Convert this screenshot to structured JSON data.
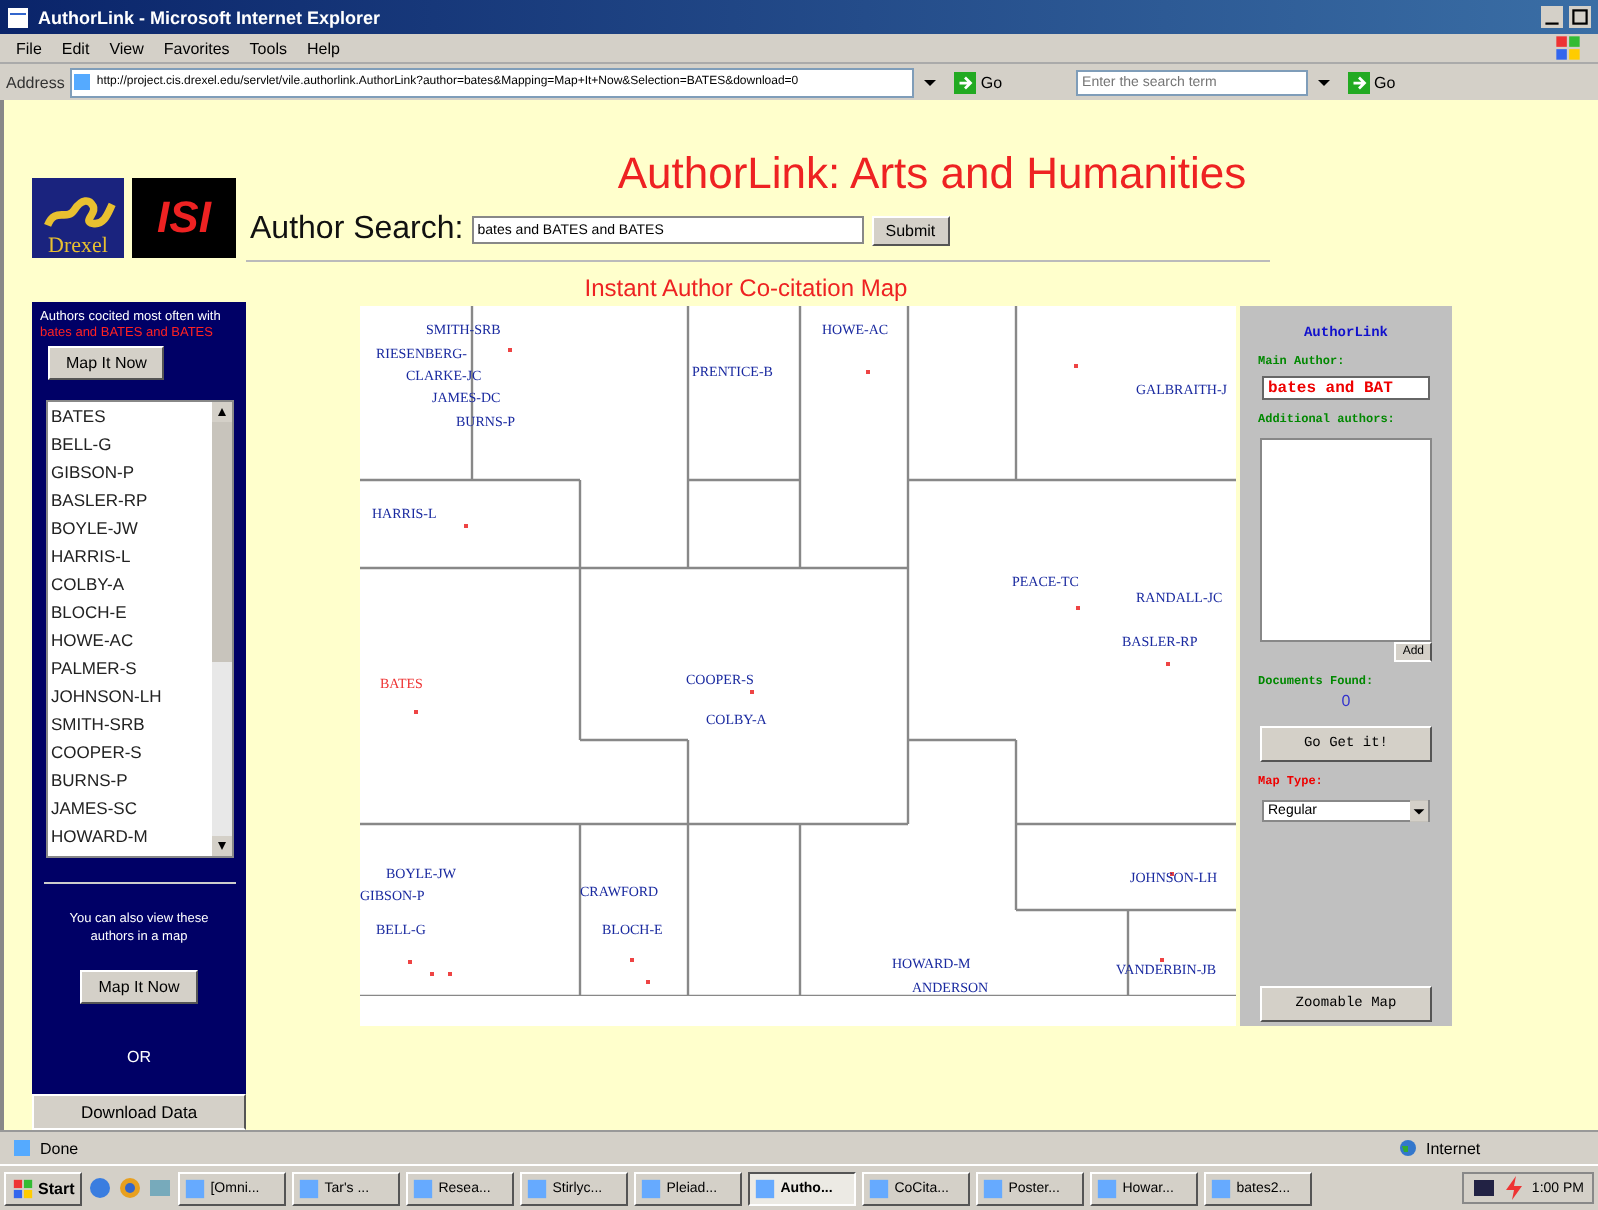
{
  "window": {
    "title": "AuthorLink - Microsoft Internet Explorer"
  },
  "menu": [
    "File",
    "Edit",
    "View",
    "Favorites",
    "Tools",
    "Help"
  ],
  "address_bar": {
    "label": "Address",
    "url": "http://project.cis.drexel.edu/servlet/vile.authorlink.AuthorLink?author=bates&Mapping=Map+It+Now&Selection=BATES&download=0",
    "go": "Go",
    "search_placeholder": "Enter the search term",
    "search_go": "Go"
  },
  "logos": {
    "drexel": "Drexel",
    "isi": "ISI"
  },
  "page_title": "AuthorLink: Arts and Humanities",
  "search": {
    "label": "Author Search:",
    "value": "bates and BATES and BATES",
    "submit": "Submit"
  },
  "sidebar": {
    "intro": "Authors cocited most often with",
    "query": "bates and BATES and BATES",
    "map_button": "Map It Now",
    "authors": [
      {
        "name": "BATES",
        "selected": false
      },
      {
        "name": "BELL-G",
        "selected": false
      },
      {
        "name": "GIBSON-P",
        "selected": false
      },
      {
        "name": "BASLER-RP",
        "selected": false
      },
      {
        "name": "BOYLE-JW",
        "selected": false
      },
      {
        "name": "HARRIS-L",
        "selected": false
      },
      {
        "name": "COLBY-A",
        "selected": false
      },
      {
        "name": "BLOCH-E",
        "selected": false
      },
      {
        "name": "HOWE-AC",
        "selected": false
      },
      {
        "name": "PALMER-S",
        "selected": false
      },
      {
        "name": "JOHNSON-LH",
        "selected": false
      },
      {
        "name": "SMITH-SRB",
        "selected": false
      },
      {
        "name": "COOPER-S",
        "selected": false
      },
      {
        "name": "BURNS-P",
        "selected": false
      },
      {
        "name": "JAMES-SC",
        "selected": false
      },
      {
        "name": "HOWARD-M",
        "selected": false
      }
    ],
    "also_text": "You can also view these authors in a map",
    "map_button_2": "Map It Now",
    "or": "OR",
    "download": "Download Data"
  },
  "map": {
    "title": "Instant Author Co-citation Map",
    "labels": [
      {
        "text": "SMITH-SRB",
        "main": false
      },
      {
        "text": "RIESENBERG-",
        "main": false
      },
      {
        "text": "CLARKE-JC",
        "main": false
      },
      {
        "text": "JAMES-DC",
        "main": false
      },
      {
        "text": "BURNS-P",
        "main": false
      },
      {
        "text": "PRENTICE-B",
        "main": false
      },
      {
        "text": "HOWE-AC",
        "main": false
      },
      {
        "text": "GALBRAITH-J",
        "main": false
      },
      {
        "text": "HARRIS-L",
        "main": false
      },
      {
        "text": "PEACE-TC",
        "main": false
      },
      {
        "text": "RANDALL-JC",
        "main": false
      },
      {
        "text": "BASLER-RP",
        "main": false
      },
      {
        "text": "BATES",
        "main": true
      },
      {
        "text": "COOPER-S",
        "main": false
      },
      {
        "text": "COLBY-A",
        "main": false
      },
      {
        "text": "BOYLE-JW",
        "main": false
      },
      {
        "text": "GIBSON-P",
        "main": false
      },
      {
        "text": "BELL-G",
        "main": false
      },
      {
        "text": "CRAWFORD",
        "main": false
      },
      {
        "text": "BLOCH-E",
        "main": false
      },
      {
        "text": "HOWARD-M",
        "main": false
      },
      {
        "text": "ANDERSON",
        "main": false
      },
      {
        "text": "JOHNSON-LH",
        "main": false
      },
      {
        "text": "VANDERBIN-JB",
        "main": false
      }
    ]
  },
  "panel": {
    "title": "AuthorLink",
    "main_author_label": "Main Author:",
    "main_author": "bates and BAT",
    "additional_label": "Additional authors:",
    "add": "Add",
    "documents_label": "Documents Found:",
    "documents": "0",
    "go_button": "Go Get it!",
    "map_type_label": "Map Type:",
    "map_type": "Regular",
    "zoom_button": "Zoomable Map"
  },
  "status_bar": {
    "text": "Done",
    "zone": "Internet"
  },
  "taskbar": {
    "start": "Start",
    "tasks": [
      {
        "label": "[Omni...",
        "selected": false
      },
      {
        "label": "Tar's ...",
        "selected": false
      },
      {
        "label": "Resea...",
        "selected": false
      },
      {
        "label": "Stirlyc...",
        "selected": false
      },
      {
        "label": "Pleiad...",
        "selected": false
      },
      {
        "label": "Autho...",
        "selected": true
      },
      {
        "label": "CoCita...",
        "selected": false
      },
      {
        "label": "Poster...",
        "selected": false
      },
      {
        "label": "Howar...",
        "selected": false
      },
      {
        "label": "bates2...",
        "selected": false
      }
    ],
    "clock": "1:00 PM"
  }
}
